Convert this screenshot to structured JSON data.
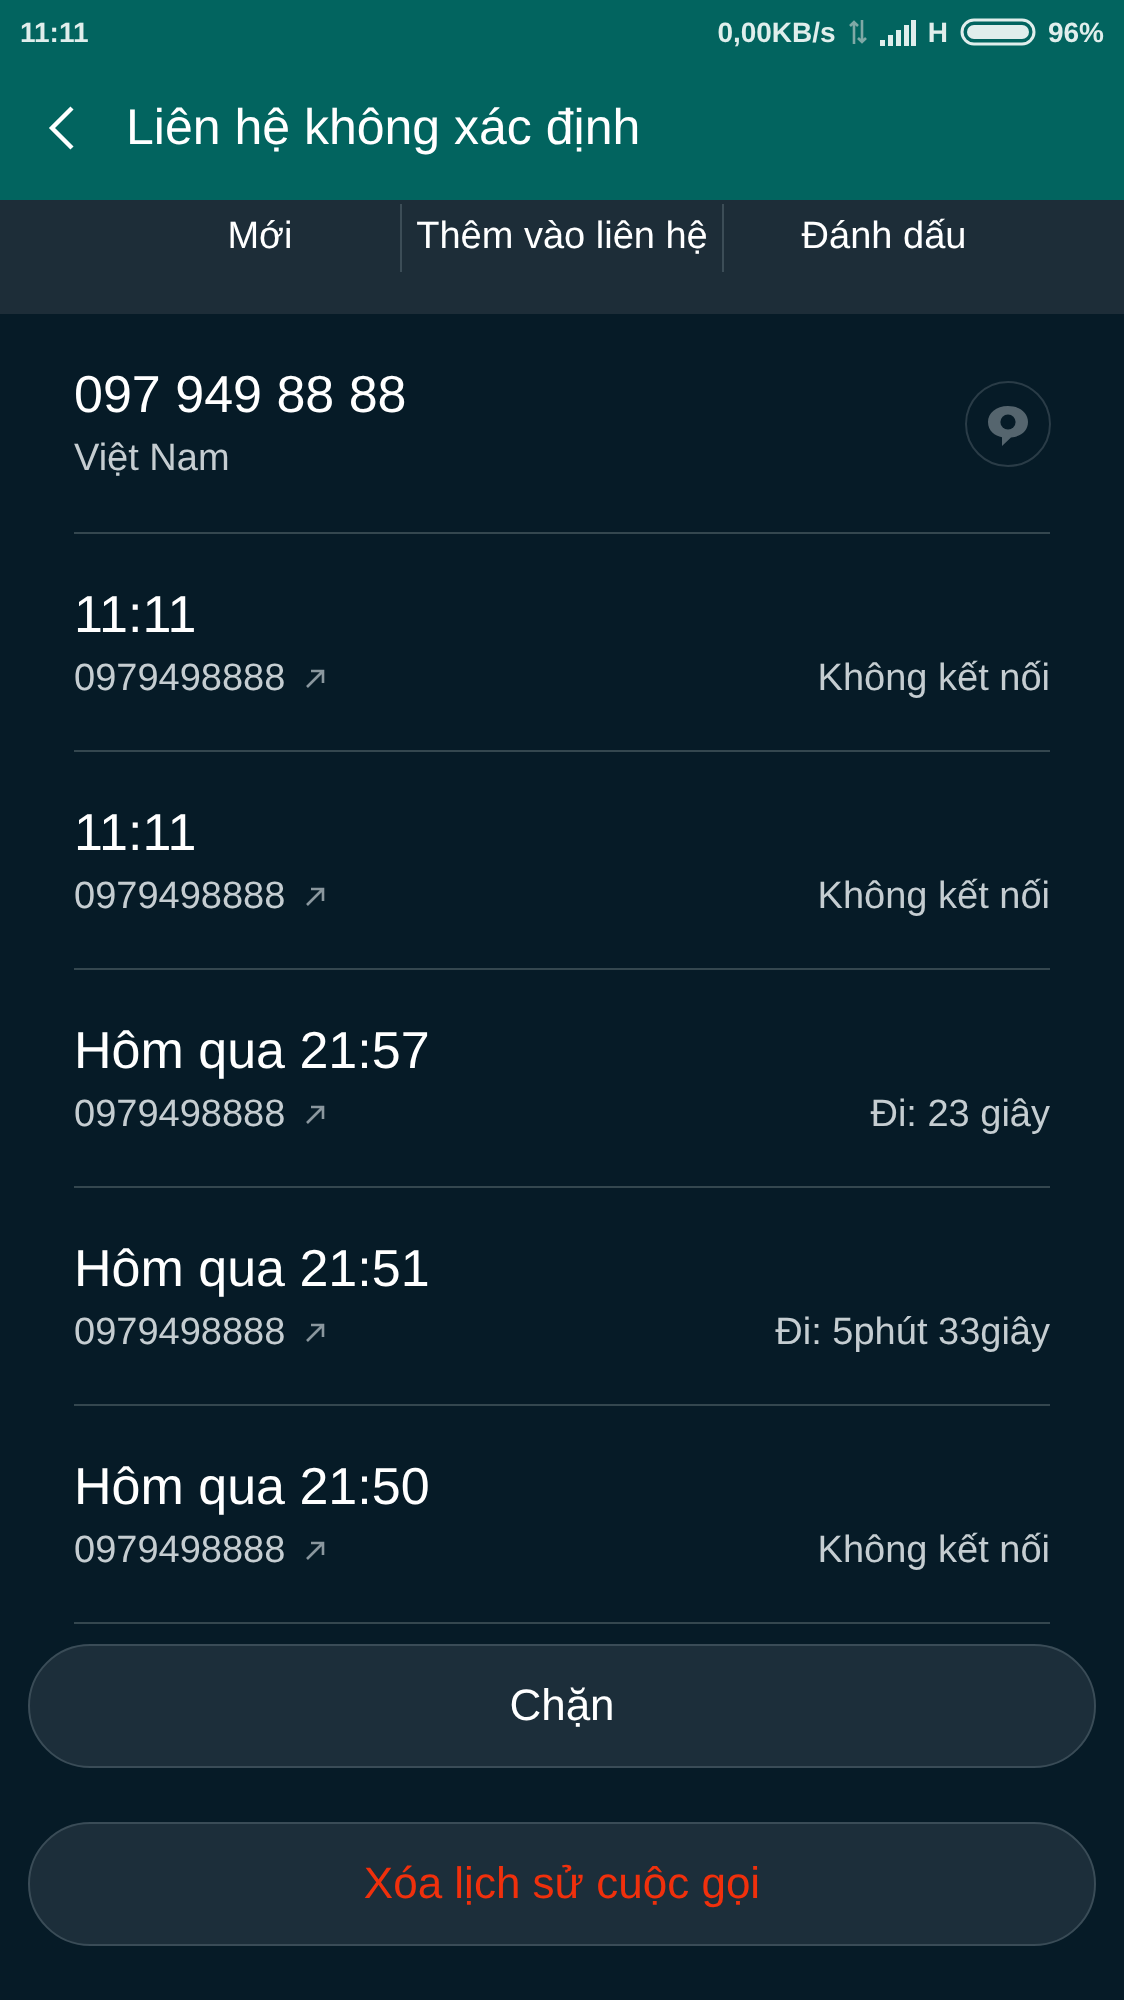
{
  "status_bar": {
    "time": "11:11",
    "speed": "0,00KB/s",
    "network": "H",
    "battery": "96%"
  },
  "header": {
    "title": "Liên hệ không xác định"
  },
  "actions": [
    "Mới",
    "Thêm vào liên hệ",
    "Đánh dấu"
  ],
  "contact": {
    "number": "097 949 88 88",
    "region": "Việt Nam"
  },
  "calls": [
    {
      "time": "11:11",
      "number": "0979498888",
      "result": "Không kết nối"
    },
    {
      "time": "11:11",
      "number": "0979498888",
      "result": "Không kết nối"
    },
    {
      "time": "Hôm qua 21:57",
      "number": "0979498888",
      "result": "Đi: 23 giây"
    },
    {
      "time": "Hôm qua 21:51",
      "number": "0979498888",
      "result": "Đi: 5phút 33giây"
    },
    {
      "time": "Hôm qua 21:50",
      "number": "0979498888",
      "result": "Không kết nối"
    }
  ],
  "buttons": [
    {
      "label": "Chặn",
      "kind": "normal"
    },
    {
      "label": "Xóa lịch sử cuộc gọi",
      "kind": "danger"
    }
  ]
}
